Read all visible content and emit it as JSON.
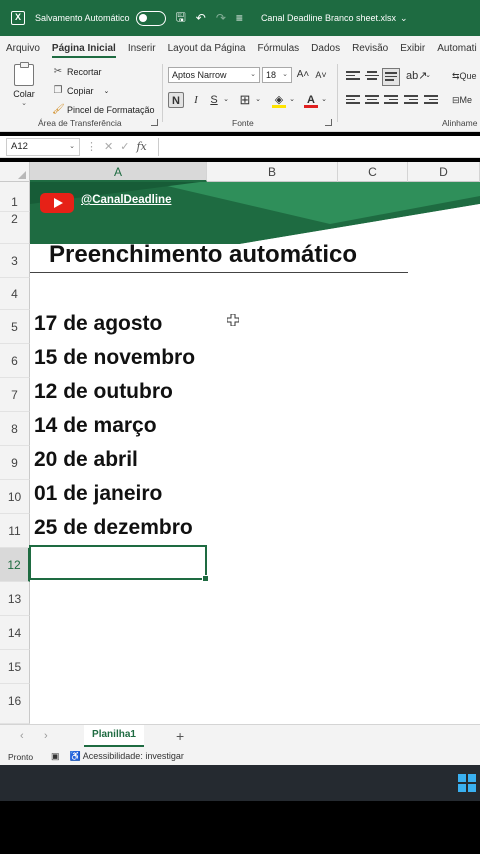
{
  "titlebar": {
    "app_icon": "excel-icon",
    "autosave_label": "Salvamento Automático",
    "autosave_state": "off",
    "filename": "Canal Deadline Branco sheet.xlsx",
    "accent": "#1e6b41"
  },
  "menu": {
    "tabs": [
      "Arquivo",
      "Página Inicial",
      "Inserir",
      "Layout da Página",
      "Fórmulas",
      "Dados",
      "Revisão",
      "Exibir",
      "Automati"
    ],
    "active": "Página Inicial"
  },
  "ribbon": {
    "clipboard": {
      "paste": "Colar",
      "cut": "Recortar",
      "copy": "Copiar",
      "format_painter": "Pincel de Formatação",
      "label": "Área de Transferência"
    },
    "font": {
      "family": "Aptos Narrow",
      "size": "18",
      "bold": "N",
      "italic": "I",
      "underline": "S",
      "label": "Fonte"
    },
    "alignment": {
      "label": "Alinhame",
      "wrap_partial": "Que",
      "merge_partial": "Me"
    }
  },
  "formula_bar": {
    "cell_ref": "A12",
    "fx": "fx",
    "content": ""
  },
  "columns": [
    {
      "key": "A",
      "active": true
    },
    {
      "key": "B",
      "active": false
    },
    {
      "key": "C",
      "active": false
    },
    {
      "key": "D",
      "active": false
    }
  ],
  "rows": [
    {
      "key": "1",
      "active": false
    },
    {
      "key": "2",
      "active": false
    },
    {
      "key": "3",
      "active": false
    },
    {
      "key": "4",
      "active": false
    },
    {
      "key": "5",
      "active": false
    },
    {
      "key": "6",
      "active": false
    },
    {
      "key": "7",
      "active": false
    },
    {
      "key": "8",
      "active": false
    },
    {
      "key": "9",
      "active": false
    },
    {
      "key": "10",
      "active": false
    },
    {
      "key": "11",
      "active": false
    },
    {
      "key": "12",
      "active": true
    },
    {
      "key": "13",
      "active": false
    },
    {
      "key": "14",
      "active": false
    },
    {
      "key": "15",
      "active": false
    },
    {
      "key": "16",
      "active": false
    }
  ],
  "banner": {
    "channel": "@CanalDeadline",
    "green_dark": "#1e6b41",
    "green_light": "#2f8f5a"
  },
  "content": {
    "title": "Preenchimento automático",
    "dates": [
      "17 de agosto",
      "15 de novembro",
      "12 de outubro",
      "14 de março",
      "20 de abril",
      "01 de janeiro",
      "25 de dezembro"
    ]
  },
  "sheet_tabs": {
    "active": "Planilha1",
    "add": "+"
  },
  "status": {
    "ready": "Pronto",
    "accessibility": "Acessibilidade: investigar"
  }
}
